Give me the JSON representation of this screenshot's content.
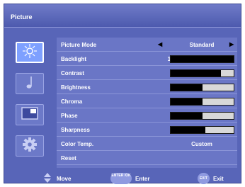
{
  "window": {
    "title": "Picture"
  },
  "sidebar": {
    "items": [
      {
        "icon": "brightness-icon",
        "selected": true
      },
      {
        "icon": "music-note-icon",
        "selected": false
      },
      {
        "icon": "window-icon",
        "selected": false
      },
      {
        "icon": "gear-icon",
        "selected": false
      }
    ]
  },
  "menu": {
    "picture_mode": {
      "label": "Picture Mode",
      "value": "Standard"
    },
    "backlight": {
      "label": "Backlight",
      "value": "100",
      "level": 100
    },
    "contrast": {
      "label": "Contrast",
      "value": "80",
      "level": 80
    },
    "brightness": {
      "label": "Brightness",
      "value": "50",
      "level": 50
    },
    "chroma": {
      "label": "Chroma",
      "value": "50",
      "level": 50
    },
    "phase": {
      "label": "Phase",
      "value": "50",
      "level": 50
    },
    "sharpness": {
      "label": "Sharpness",
      "value": "5",
      "level": 55
    },
    "color_temp": {
      "label": "Color Temp.",
      "value": "Custom"
    },
    "reset": {
      "label": "Reset"
    }
  },
  "footer": {
    "move_label": "Move",
    "enter_key": "ENTER /OK",
    "enter_label": "Enter",
    "exit_key": "EXIT",
    "exit_label": "Exit"
  },
  "colors": {
    "accent": "#5865b8",
    "panel": "#6a76c6",
    "highlight": "#7ea0ff"
  }
}
